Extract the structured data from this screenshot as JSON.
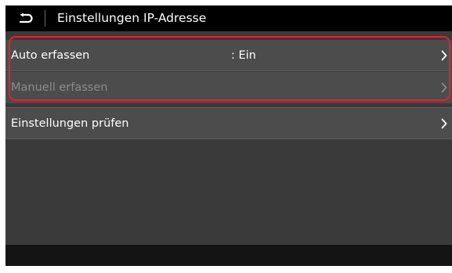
{
  "header": {
    "back_icon": "back-arrow-icon",
    "title": "Einstellungen IP-Adresse"
  },
  "rows": [
    {
      "label": "Auto erfassen",
      "value": ": Ein",
      "enabled": true,
      "icon": "chevron-right-icon"
    },
    {
      "label": "Manuell erfassen",
      "value": "",
      "enabled": false,
      "icon": "chevron-right-icon"
    },
    {
      "label": "Einstellungen prüfen",
      "value": "",
      "enabled": true,
      "icon": "chevron-right-icon"
    }
  ],
  "colors": {
    "header_bg": "#000000",
    "screen_bg": "#3a3a3a",
    "row_bg": "#4c4c4c",
    "text": "#ffffff",
    "disabled_text": "#8c8c8c",
    "highlight": "#e8202a"
  }
}
